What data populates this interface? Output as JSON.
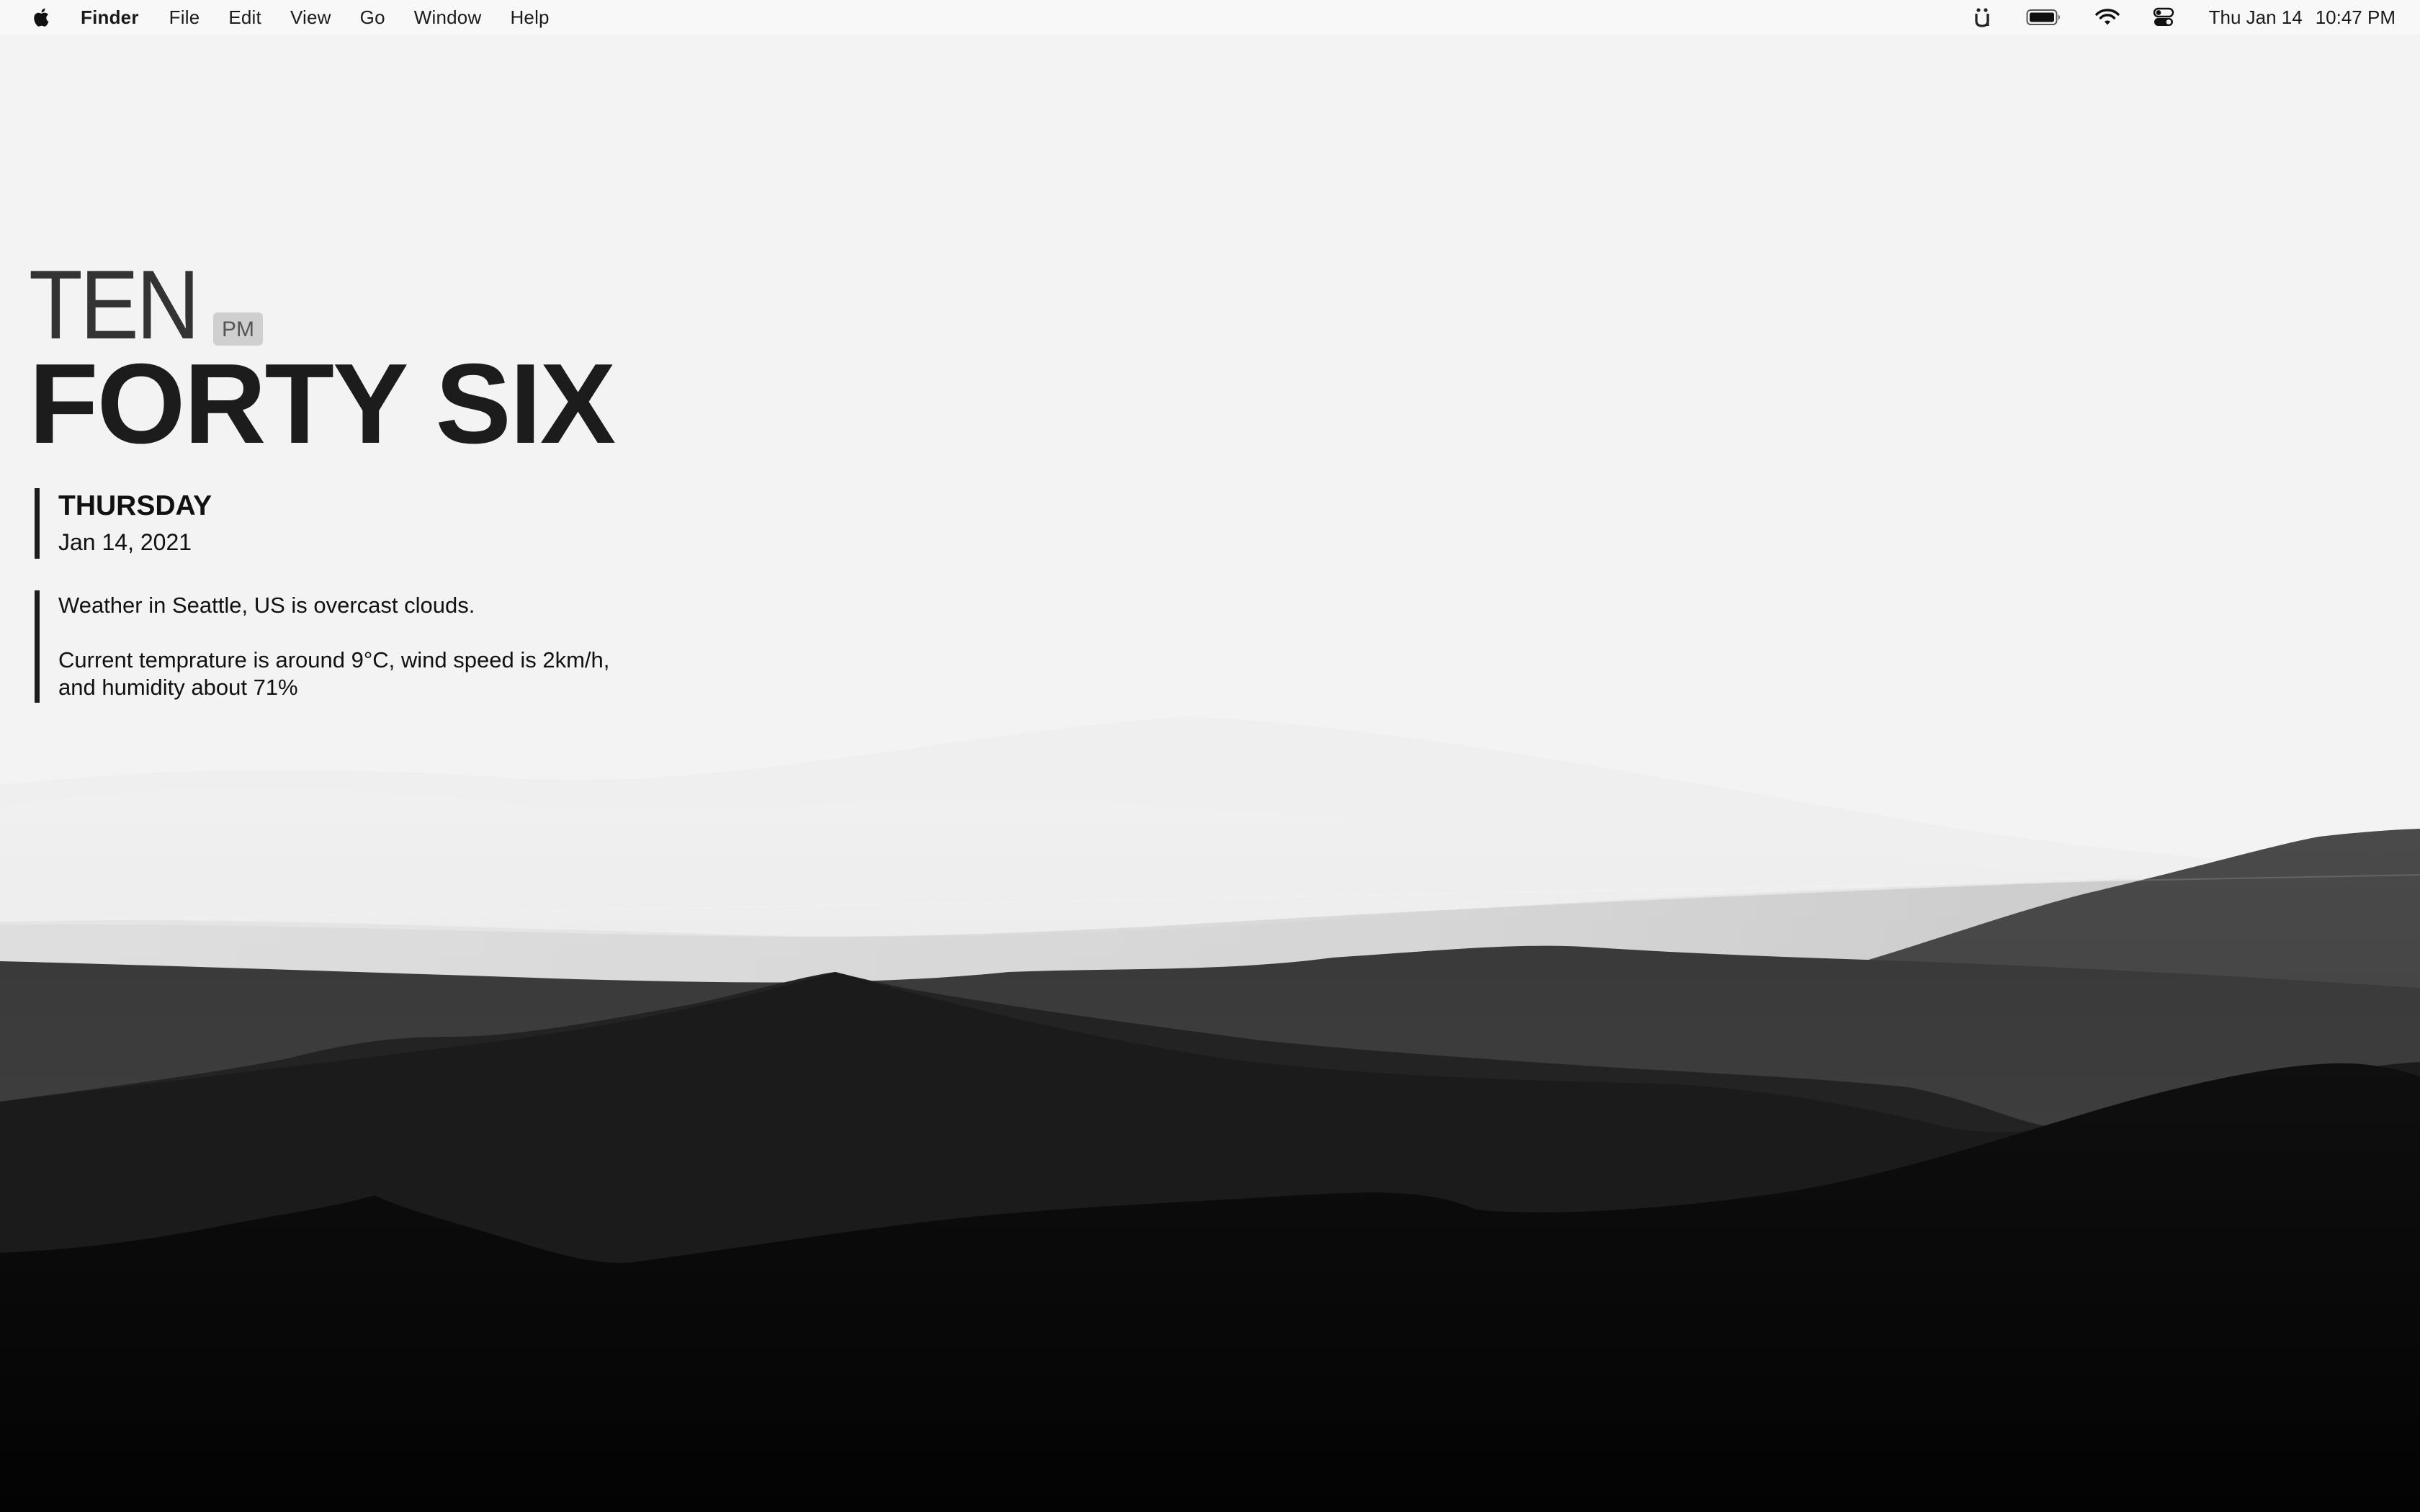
{
  "menubar": {
    "apple_icon": "apple-logo-icon",
    "app_name": "Finder",
    "menus": [
      "File",
      "Edit",
      "View",
      "Go",
      "Window",
      "Help"
    ],
    "status_icons": [
      "ubersicht-icon",
      "battery-icon",
      "wifi-icon",
      "control-center-icon"
    ],
    "clock": {
      "date": "Thu Jan 14",
      "time": "10:47 PM"
    }
  },
  "widget": {
    "hour_word": "TEN",
    "ampm": "PM",
    "minute_words": "FORTY SIX",
    "weekday": "THURSDAY",
    "date": "Jan 14, 2021",
    "weather_line1": "Weather in Seattle, US is overcast clouds.",
    "weather_line2a": "Current temprature is around 9°C, wind speed is 2km/h,",
    "weather_line2b": "and humidity about 71%"
  },
  "wallpaper": {
    "description_colors": [
      "#f3f3f3",
      "#d9d9d9",
      "#4a4a4a",
      "#222222",
      "#050505"
    ]
  }
}
